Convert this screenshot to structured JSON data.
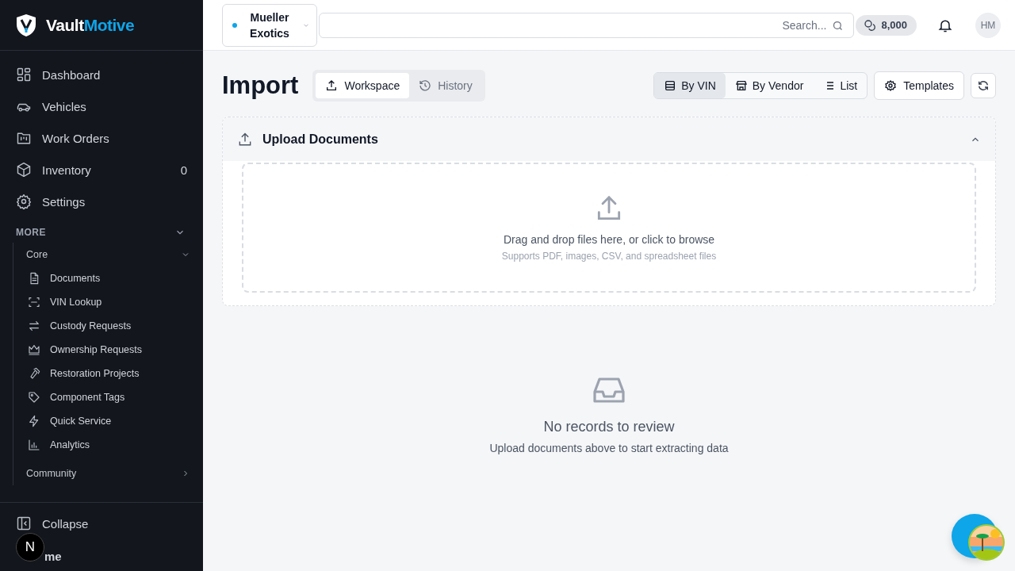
{
  "brand": {
    "primary": "Vault",
    "accent": "Motive"
  },
  "nav": [
    {
      "label": "Dashboard"
    },
    {
      "label": "Vehicles"
    },
    {
      "label": "Work Orders"
    },
    {
      "label": "Inventory",
      "count": "0"
    },
    {
      "label": "Settings"
    }
  ],
  "more": {
    "label": "MORE",
    "expanded": true,
    "groups": [
      {
        "label": "Core",
        "expanded": true,
        "items": [
          {
            "label": "Documents"
          },
          {
            "label": "VIN Lookup"
          },
          {
            "label": "Custody Requests"
          },
          {
            "label": "Ownership Requests"
          },
          {
            "label": "Restoration Projects"
          },
          {
            "label": "Component Tags"
          },
          {
            "label": "Quick Service"
          },
          {
            "label": "Analytics"
          }
        ]
      },
      {
        "label": "Community",
        "expanded": false
      }
    ]
  },
  "footer": {
    "collapse": "Collapse",
    "theme": "me",
    "dev_badge": "N"
  },
  "header": {
    "org": "Mueller Exotics",
    "search": {
      "placeholder": "Search..."
    },
    "credits": "8,000",
    "avatar": "HM"
  },
  "page": {
    "title": "Import",
    "tabs": [
      {
        "label": "Workspace",
        "selected": true
      },
      {
        "label": "History",
        "selected": false
      }
    ],
    "views": [
      {
        "label": "By VIN",
        "selected": true
      },
      {
        "label": "By Vendor",
        "selected": false
      },
      {
        "label": "List",
        "selected": false
      }
    ],
    "templates": "Templates"
  },
  "upload": {
    "title": "Upload Documents",
    "expanded": true,
    "drop_text": "Drag and drop files here, or click to browse",
    "hint": "Supports PDF, images, CSV, and spreadsheet files"
  },
  "empty": {
    "title": "No records to review",
    "text": "Upload documents above to start extracting data"
  }
}
